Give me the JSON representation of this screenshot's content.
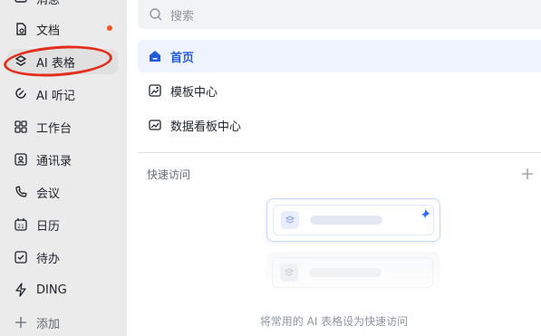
{
  "sidebar": {
    "items": [
      {
        "label": "消息",
        "icon": "message-icon"
      },
      {
        "label": "文档",
        "icon": "document-icon",
        "badge_dot": true
      },
      {
        "label": "AI 表格",
        "icon": "ai-table-icon",
        "active": true
      },
      {
        "label": "AI 听记",
        "icon": "ai-note-icon"
      },
      {
        "label": "工作台",
        "icon": "workbench-icon"
      },
      {
        "label": "通讯录",
        "icon": "contacts-icon"
      },
      {
        "label": "会议",
        "icon": "meeting-icon"
      },
      {
        "label": "日历",
        "icon": "calendar-icon"
      },
      {
        "label": "待办",
        "icon": "todo-icon"
      },
      {
        "label": "DING",
        "icon": "ding-icon"
      },
      {
        "label": "添加",
        "icon": "plus-icon"
      }
    ]
  },
  "search": {
    "placeholder": "搜索"
  },
  "menu": {
    "home": "首页",
    "templates": "模板中心",
    "dashboard": "数据看板中心"
  },
  "quick_access": {
    "title": "快速访问",
    "hint": "将常用的 AI 表格设为快速访问"
  },
  "colors": {
    "accent": "#245bdb",
    "annotation_circle": "#e32d1d",
    "badge_dot": "#f25b1f"
  }
}
